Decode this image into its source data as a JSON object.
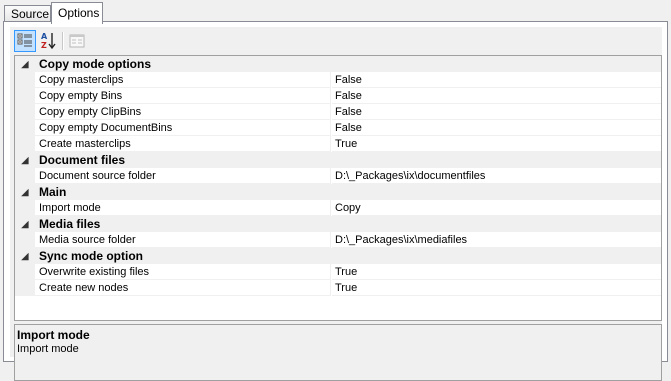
{
  "tabs": {
    "source_label": "Source",
    "options_label": "Options"
  },
  "toolbar": {
    "categorized_icon": "categorized-view-icon",
    "alphabetical_icon": "alphabetical-sort-icon",
    "property_pages_icon": "property-pages-icon"
  },
  "groups": [
    {
      "label": "Copy mode options",
      "properties": [
        {
          "name": "Copy masterclips",
          "value": "False"
        },
        {
          "name": "Copy empty Bins",
          "value": "False"
        },
        {
          "name": "Copy empty ClipBins",
          "value": "False"
        },
        {
          "name": "Copy empty DocumentBins",
          "value": "False"
        },
        {
          "name": "Create masterclips",
          "value": "True"
        }
      ]
    },
    {
      "label": "Document files",
      "properties": [
        {
          "name": "Document source folder",
          "value": "D:\\_Packages\\ix\\documentfiles"
        }
      ]
    },
    {
      "label": "Main",
      "properties": [
        {
          "name": "Import mode",
          "value": "Copy"
        }
      ]
    },
    {
      "label": "Media files",
      "properties": [
        {
          "name": "Media source folder",
          "value": "D:\\_Packages\\ix\\mediafiles"
        }
      ]
    },
    {
      "label": "Sync mode option",
      "properties": [
        {
          "name": "Overwrite existing files",
          "value": "True"
        },
        {
          "name": "Create new nodes",
          "value": "True"
        }
      ]
    }
  ],
  "help": {
    "title": "Import mode",
    "description": "Import mode"
  },
  "colors": {
    "selected_button_border": "#3399ff",
    "selected_button_fill": "#c2e0ff",
    "category_bg": "#f0f0f0"
  }
}
